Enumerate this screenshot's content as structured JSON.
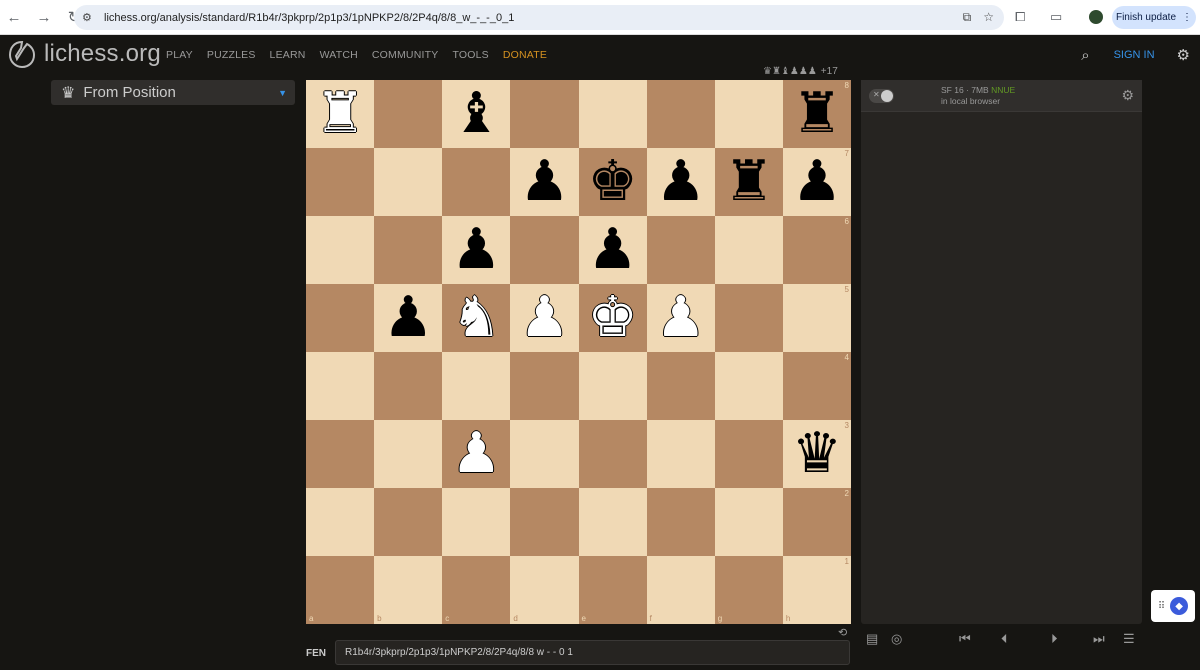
{
  "browser": {
    "url": "lichess.org/analysis/standard/R1b4r/3pkprp/2p1p3/1pNPKP2/8/2P4q/8/8_w_-_-_0_1",
    "finish_update_label": "Finish update"
  },
  "site": {
    "logo_text": "lichess.org",
    "nav": [
      "PLAY",
      "PUZZLES",
      "LEARN",
      "WATCH",
      "COMMUNITY",
      "TOOLS",
      "DONATE"
    ],
    "sign_in": "SIGN IN"
  },
  "left_panel": {
    "variant_label": "From Position"
  },
  "material": {
    "pieces": "♛♜♝♟♟♟",
    "diff": "+17"
  },
  "board": {
    "ranks": [
      "8",
      "7",
      "6",
      "5",
      "4",
      "3",
      "2",
      "1"
    ],
    "files": [
      "a",
      "b",
      "c",
      "d",
      "e",
      "f",
      "g",
      "h"
    ],
    "rows": [
      [
        "R",
        "",
        "b",
        "",
        "",
        "",
        "",
        "r"
      ],
      [
        "",
        "",
        "",
        "p",
        "k",
        "p",
        "r",
        "p"
      ],
      [
        "",
        "",
        "p",
        "",
        "p",
        "",
        "",
        ""
      ],
      [
        "",
        "p",
        "N",
        "P",
        "K",
        "P",
        "",
        ""
      ],
      [
        "",
        "",
        "",
        "",
        "",
        "",
        "",
        ""
      ],
      [
        "",
        "",
        "P",
        "",
        "",
        "",
        "",
        "q"
      ],
      [
        "",
        "",
        "",
        "",
        "",
        "",
        "",
        ""
      ],
      [
        "",
        "",
        "",
        "",
        "",
        "",
        "",
        ""
      ]
    ]
  },
  "engine": {
    "name": "SF 16 · 7MB",
    "tag": "NNUE",
    "subtitle": "in local browser"
  },
  "fen": {
    "label": "FEN",
    "value": "R1b4r/3pkprp/2p1p3/1pNPKP2/8/2P4q/8/8 w - - 0 1"
  }
}
